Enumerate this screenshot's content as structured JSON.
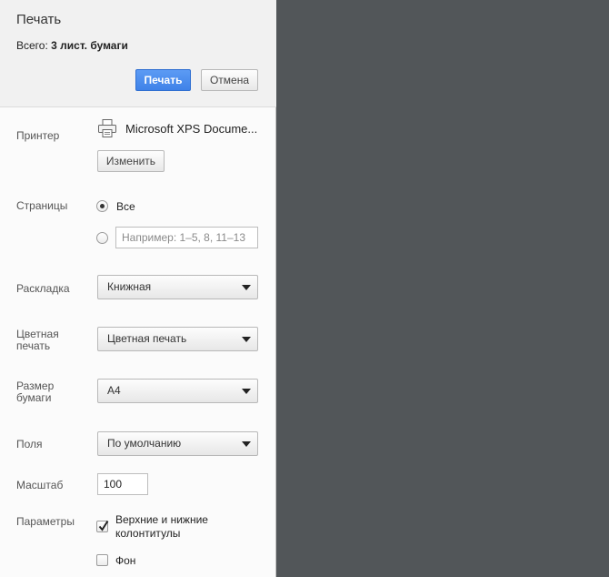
{
  "header": {
    "title": "Печать",
    "summary_prefix": "Всего: ",
    "summary_value": "3 лист. бумаги",
    "print_label": "Печать",
    "cancel_label": "Отмена"
  },
  "printer": {
    "label": "Принтер",
    "name": "Microsoft XPS Docume...",
    "change_label": "Изменить"
  },
  "pages": {
    "label": "Страницы",
    "all_label": "Все",
    "selected": "all",
    "custom_placeholder": "Например: 1–5, 8, 11–13"
  },
  "layout": {
    "label": "Раскладка",
    "value": "Книжная"
  },
  "color": {
    "label_line1": "Цветная",
    "label_line2": "печать",
    "value": "Цветная печать"
  },
  "paper": {
    "label_line1": "Размер",
    "label_line2": "бумаги",
    "value": "A4"
  },
  "margins": {
    "label": "Поля",
    "value": "По умолчанию"
  },
  "scale": {
    "label": "Масштаб",
    "value": "100"
  },
  "options": {
    "label": "Параметры",
    "headers_footers_line1": "Верхние и нижние",
    "headers_footers_line2": "колонтитулы",
    "headers_footers_checked": true,
    "background_label": "Фон",
    "background_checked": false
  },
  "colors": {
    "primary": "#4a8af4",
    "preview_bg": "#525659",
    "sidebar_bg": "#fbfbfb"
  }
}
